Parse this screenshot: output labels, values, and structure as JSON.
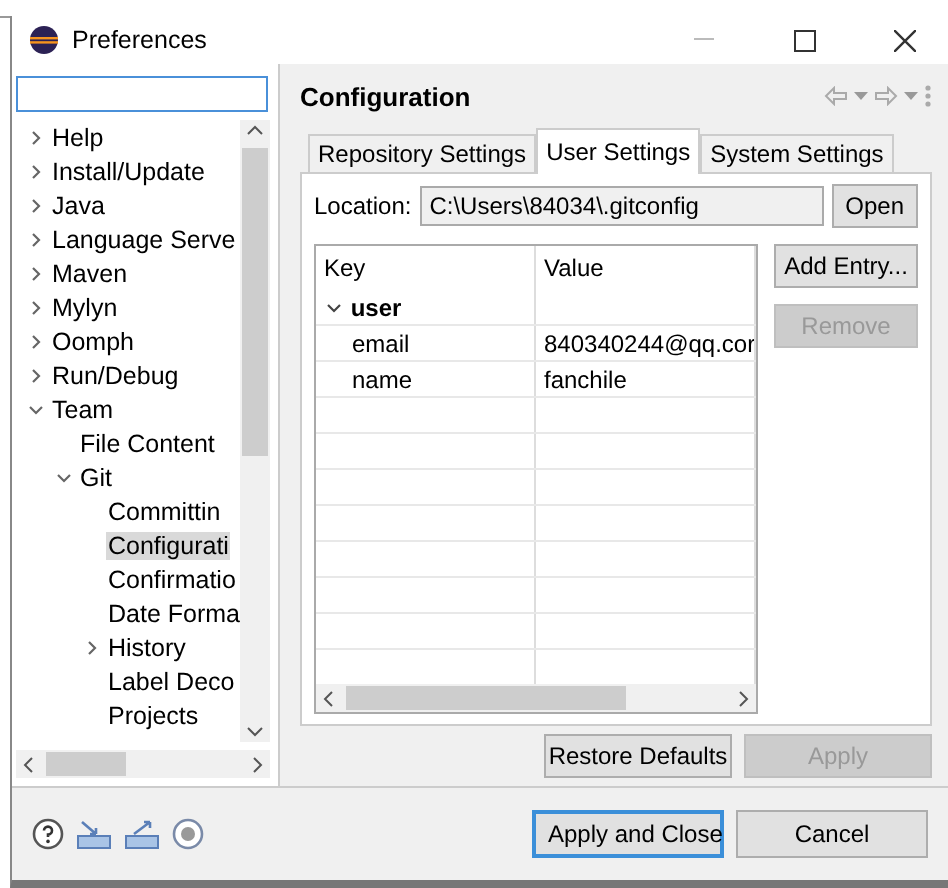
{
  "window": {
    "title": "Preferences"
  },
  "tree": [
    {
      "label": "Help",
      "expanded": false,
      "selected": false
    },
    {
      "label": "Install/Update",
      "expanded": false,
      "selected": false
    },
    {
      "label": "Java",
      "expanded": false,
      "selected": false
    },
    {
      "label": "Language Serve",
      "expanded": false,
      "selected": false
    },
    {
      "label": "Maven",
      "expanded": false,
      "selected": false
    },
    {
      "label": "Mylyn",
      "expanded": false,
      "selected": false
    },
    {
      "label": "Oomph",
      "expanded": false,
      "selected": false
    },
    {
      "label": "Run/Debug",
      "expanded": false,
      "selected": false
    },
    {
      "label": "Team",
      "expanded": true,
      "selected": false,
      "children": [
        {
          "label": "File Content",
          "selected": false
        },
        {
          "label": "Git",
          "expanded": true,
          "selected": false,
          "children": [
            {
              "label": "Committin",
              "selected": false
            },
            {
              "label": "Configurati",
              "selected": true
            },
            {
              "label": "Confirmatio",
              "selected": false
            },
            {
              "label": "Date Forma",
              "selected": false
            },
            {
              "label": "History",
              "expanded": false,
              "selected": false
            },
            {
              "label": "Label Deco",
              "selected": false
            },
            {
              "label": "Projects",
              "selected": false
            }
          ]
        }
      ]
    }
  ],
  "page": {
    "title": "Configuration"
  },
  "tabs": [
    {
      "label": "Repository Settings",
      "selected": false
    },
    {
      "label": "User Settings",
      "selected": true
    },
    {
      "label": "System Settings",
      "selected": false
    }
  ],
  "location": {
    "label": "Location:",
    "value": "C:\\Users\\84034\\.gitconfig",
    "button": "Open"
  },
  "table": {
    "columns": [
      "Key",
      "Value"
    ],
    "rows": [
      {
        "key": "user",
        "expanded": true,
        "children": [
          {
            "key": "email",
            "value": "840340244@qq.cor"
          },
          {
            "key": "name",
            "value": "fanchile"
          }
        ]
      }
    ]
  },
  "side_buttons": [
    {
      "label": "Add Entry...",
      "disabled": false
    },
    {
      "label": "Remove",
      "disabled": true
    }
  ],
  "page_buttons": [
    {
      "label": "Restore Defaults",
      "disabled": false
    },
    {
      "label": "Apply",
      "disabled": true
    }
  ],
  "dialog_buttons": [
    {
      "label": "Apply and Close",
      "default": true
    },
    {
      "label": "Cancel",
      "default": false
    }
  ]
}
